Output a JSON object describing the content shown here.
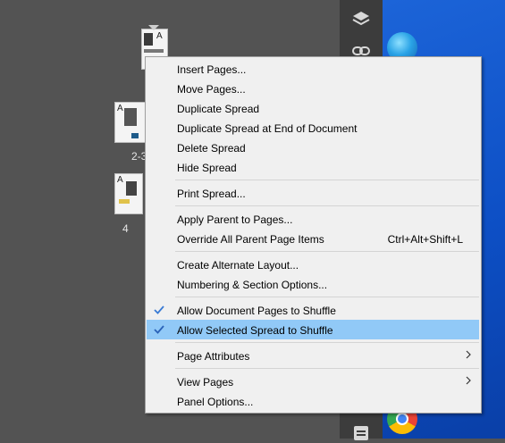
{
  "pages_panel": {
    "thumb_letter": "A",
    "spread_label": "2-3",
    "page4_label": "4"
  },
  "menu": {
    "items": [
      {
        "label": "Insert Pages..."
      },
      {
        "label": "Move Pages..."
      },
      {
        "label": "Duplicate Spread"
      },
      {
        "label": "Duplicate Spread at End of Document"
      },
      {
        "label": "Delete Spread"
      },
      {
        "label": "Hide Spread"
      },
      {
        "label": "Print Spread..."
      },
      {
        "label": "Apply Parent to Pages..."
      },
      {
        "label": "Override All Parent Page Items",
        "shortcut": "Ctrl+Alt+Shift+L"
      },
      {
        "label": "Create Alternate Layout..."
      },
      {
        "label": "Numbering & Section Options..."
      },
      {
        "label": "Allow Document Pages to Shuffle",
        "checked": true
      },
      {
        "label": "Allow Selected Spread to Shuffle",
        "checked": true,
        "highlighted": true
      },
      {
        "label": "Page Attributes",
        "submenu": true
      },
      {
        "label": "View Pages",
        "submenu": true
      },
      {
        "label": "Panel Options..."
      }
    ]
  },
  "colors": {
    "highlight": "#91c9f7",
    "check": "#3a7bd5",
    "panel_bg": "#535353"
  }
}
